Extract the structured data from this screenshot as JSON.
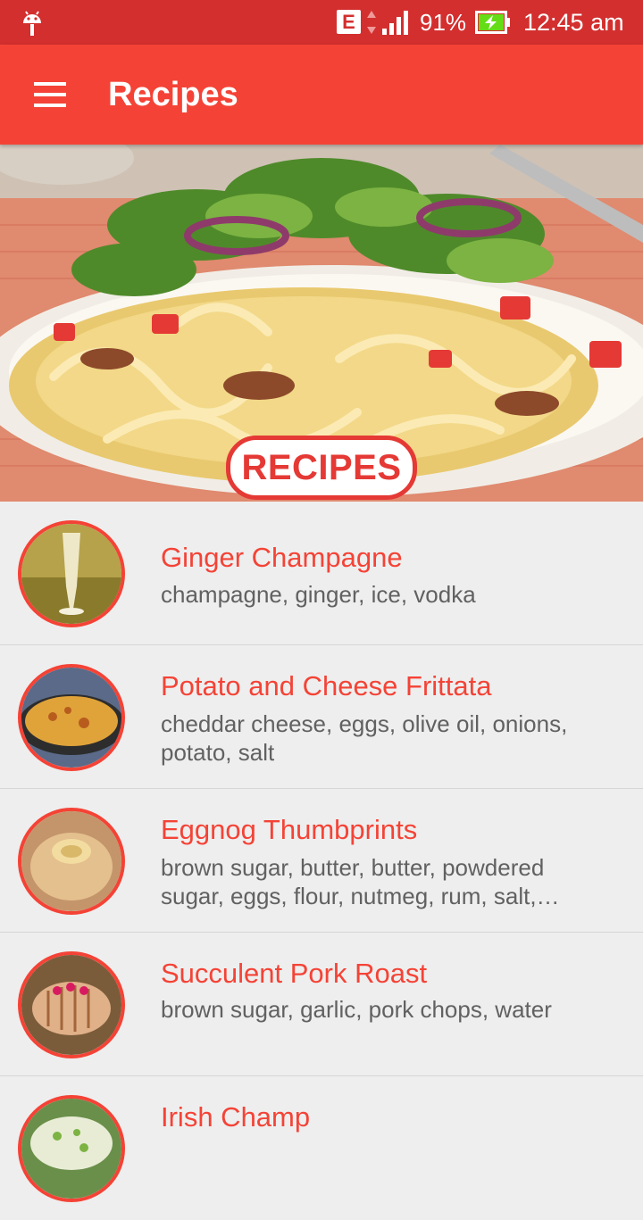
{
  "status_bar": {
    "network_type": "E",
    "battery_percent": "91%",
    "time": "12:45 am"
  },
  "app_bar": {
    "title": "Recipes",
    "menu_icon": "hamburger-menu-icon"
  },
  "hero": {
    "badge_text": "RECIPES"
  },
  "recipes": [
    {
      "name": "Ginger Champagne",
      "ingredients": "champagne, ginger, ice, vodka"
    },
    {
      "name": "Potato and Cheese Frittata",
      "ingredients": "cheddar cheese, eggs, olive oil, onions, potato, salt"
    },
    {
      "name": "Eggnog Thumbprints",
      "ingredients": "brown sugar, butter, butter, powdered sugar, eggs, flour, nutmeg, rum, salt,…"
    },
    {
      "name": "Succulent Pork Roast",
      "ingredients": "brown sugar, garlic, pork chops, water"
    },
    {
      "name": "Irish Champ",
      "ingredients": ""
    }
  ],
  "colors": {
    "status_bar": "#d32f2f",
    "primary": "#f44336",
    "background": "#eeeeee",
    "secondary_text": "#616161"
  }
}
